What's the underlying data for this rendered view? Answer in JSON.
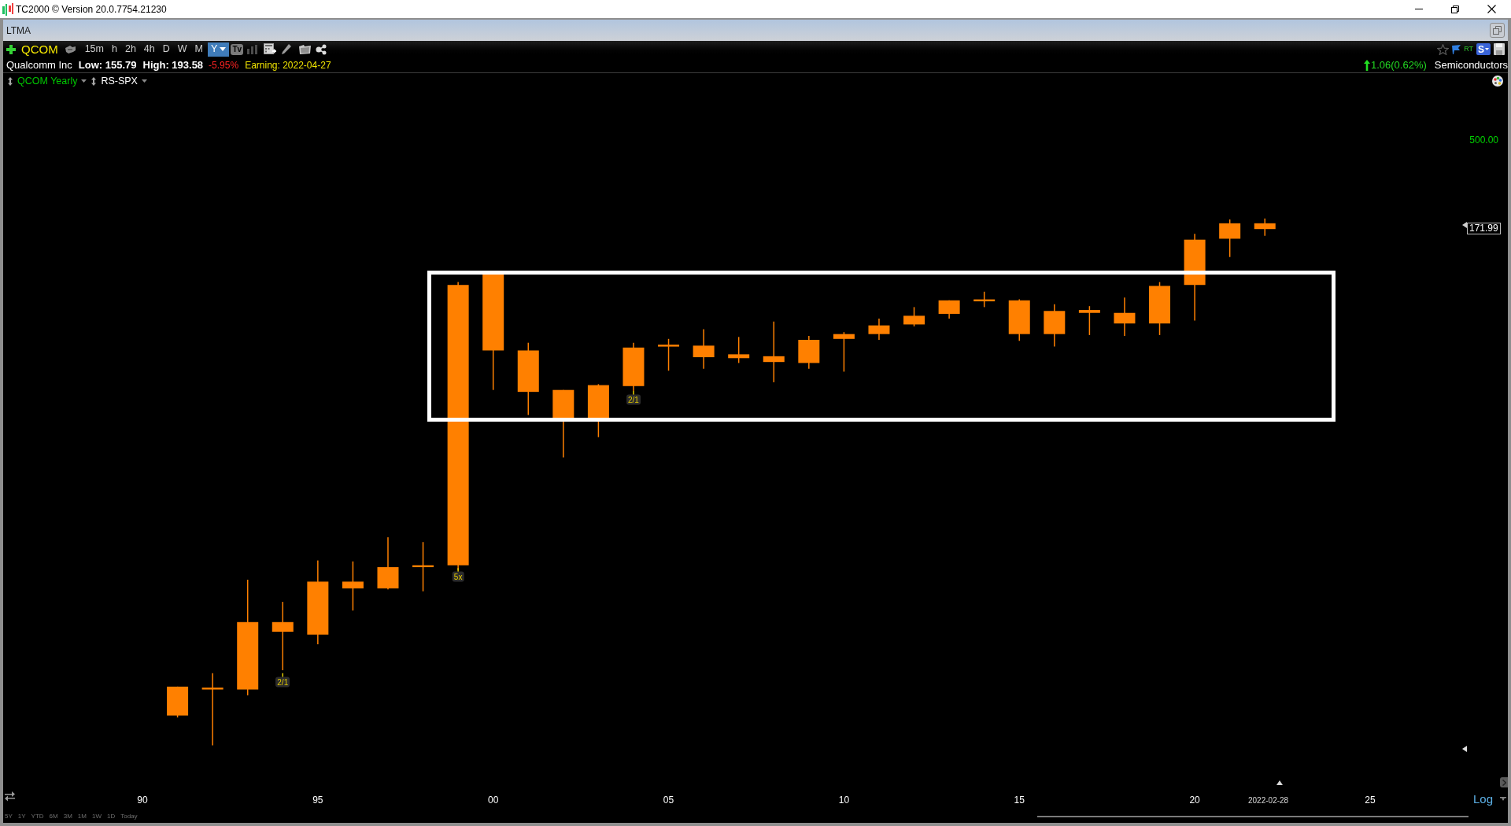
{
  "window": {
    "title": "TC2000 © Version 20.0.7754.21230"
  },
  "layout_tab": {
    "title": "LTMA"
  },
  "toolbar": {
    "symbol": "QCOM",
    "timeframes": [
      {
        "label": "15m",
        "selected": false
      },
      {
        "label": "h",
        "selected": false
      },
      {
        "label": "2h",
        "selected": false
      },
      {
        "label": "4h",
        "selected": false
      },
      {
        "label": "D",
        "selected": false
      },
      {
        "label": "W",
        "selected": false
      },
      {
        "label": "M",
        "selected": false
      },
      {
        "label": "Y",
        "selected": true
      }
    ],
    "tv_button": "Tv",
    "rt_badge": "RT",
    "scan_button": "S"
  },
  "quote": {
    "name": "Qualcomm Inc",
    "low": "Low: 155.79",
    "high": "High: 193.58",
    "change_percent": "-5.95%",
    "earning": "Earning: 2022-04-27",
    "net_change": "1.06(0.62%)",
    "industry": "Semiconductors"
  },
  "indicators": [
    {
      "label": "QCOM Yearly",
      "color": "#00c800"
    },
    {
      "label": "RS-SPX",
      "color": "#ffffff"
    }
  ],
  "chart": {
    "price_tick": "500.00",
    "last_price": "171.99",
    "x_labels": [
      "90",
      "95",
      "00",
      "05",
      "10",
      "15",
      "20",
      "25"
    ],
    "split_marks": [
      "2/1",
      "5x",
      "2/1"
    ],
    "cursor_date": "2022-02-28",
    "scale_button": "Log"
  },
  "periods": [
    "5Y",
    "1Y",
    "YTD",
    "6M",
    "3M",
    "1M",
    "1W",
    "1D",
    "Today"
  ]
}
